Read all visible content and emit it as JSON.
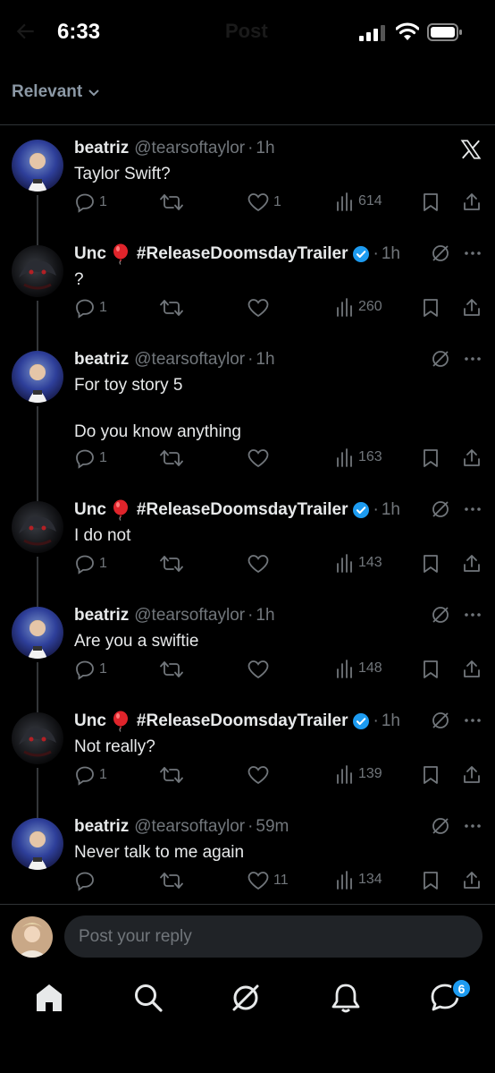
{
  "status": {
    "time": "6:33",
    "ghost_title": "Post"
  },
  "filter": {
    "label": "Relevant"
  },
  "posts": [
    {
      "name": "beatriz",
      "handle": "@tearsoftaylor",
      "time": "1h",
      "text": "Taylor Swift?",
      "replies": "1",
      "reposts": "",
      "likes": "1",
      "views": "614"
    },
    {
      "name": "Unc",
      "hashtag": "#ReleaseDoomsdayTrailer",
      "time": "1h",
      "text": "?",
      "replies": "1",
      "reposts": "",
      "likes": "",
      "views": "260"
    },
    {
      "name": "beatriz",
      "handle": "@tearsoftaylor",
      "time": "1h",
      "text": "For toy story 5\n\nDo you know anything",
      "replies": "1",
      "reposts": "",
      "likes": "",
      "views": "163"
    },
    {
      "name": "Unc",
      "hashtag": "#ReleaseDoomsdayTrailer",
      "time": "1h",
      "text": "I do not",
      "replies": "1",
      "reposts": "",
      "likes": "",
      "views": "143"
    },
    {
      "name": "beatriz",
      "handle": "@tearsoftaylor",
      "time": "1h",
      "text": "Are you a swiftie",
      "replies": "1",
      "reposts": "",
      "likes": "",
      "views": "148"
    },
    {
      "name": "Unc",
      "hashtag": "#ReleaseDoomsdayTrailer",
      "time": "1h",
      "text": "Not really?",
      "replies": "1",
      "reposts": "",
      "likes": "",
      "views": "139"
    },
    {
      "name": "beatriz",
      "handle": "@tearsoftaylor",
      "time": "59m",
      "text": "Never talk to me again",
      "replies": "",
      "reposts": "",
      "likes": "11",
      "views": "134"
    }
  ],
  "reply": {
    "placeholder": "Post your reply"
  },
  "nav": {
    "messages_badge": "6"
  },
  "colors": {
    "background": "#000000",
    "accent": "#1d9bf0",
    "balloon": "#e0242b",
    "muted": "#71767b"
  },
  "icons": [
    "reply-icon",
    "repost-icon",
    "like-icon",
    "views-icon",
    "bookmark-icon",
    "share-icon",
    "grok-icon",
    "more-icon",
    "x-logo-icon",
    "verified-icon",
    "balloon-icon",
    "home-icon",
    "search-icon",
    "notifications-icon",
    "messages-icon"
  ]
}
